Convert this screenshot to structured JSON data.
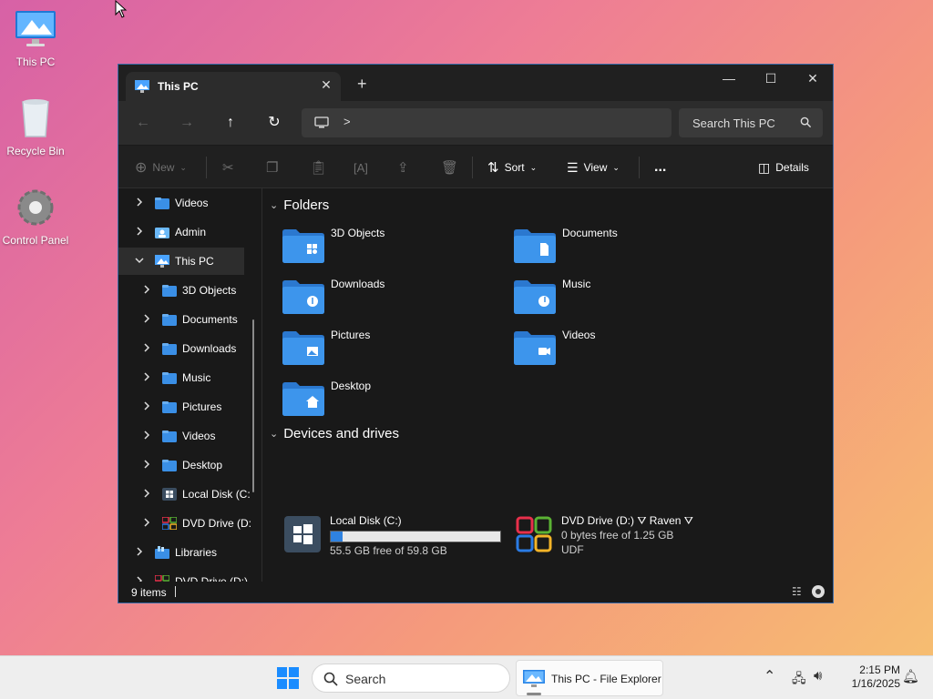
{
  "desktop": {
    "icons": [
      {
        "label": "This PC"
      },
      {
        "label": "Recycle Bin"
      },
      {
        "label": "Control Panel"
      }
    ]
  },
  "window": {
    "tab_title": "This PC",
    "toolbar": {
      "new_label": "New",
      "sort_label": "Sort",
      "view_label": "View",
      "more_label": "...",
      "details_label": "Details"
    },
    "search_placeholder": "Search This PC",
    "address_chevron": ">",
    "nav_items": [
      {
        "label": "Videos",
        "icon": "videos-folder-icon",
        "expanded": false
      },
      {
        "label": "Admin",
        "icon": "user-folder-icon",
        "expanded": false
      },
      {
        "label": "This PC",
        "icon": "this-pc-icon",
        "expanded": true,
        "selected": true
      },
      {
        "label": "3D Objects",
        "icon": "folder-icon",
        "expanded": false
      },
      {
        "label": "Documents",
        "icon": "folder-icon",
        "expanded": false
      },
      {
        "label": "Downloads",
        "icon": "folder-icon",
        "expanded": false
      },
      {
        "label": "Music",
        "icon": "folder-icon",
        "expanded": false
      },
      {
        "label": "Pictures",
        "icon": "folder-icon",
        "expanded": false
      },
      {
        "label": "Videos",
        "icon": "folder-icon",
        "expanded": false
      },
      {
        "label": "Desktop",
        "icon": "folder-icon",
        "expanded": false
      },
      {
        "label": "Local Disk (C:",
        "icon": "disk-icon",
        "expanded": false
      },
      {
        "label": "DVD Drive (D:",
        "icon": "dvd-icon",
        "expanded": false
      },
      {
        "label": "Libraries",
        "icon": "libraries-icon",
        "expanded": false
      },
      {
        "label": "DVD Drive (D:)",
        "icon": "dvd-icon",
        "expanded": false
      }
    ],
    "sections": {
      "folders": "Folders",
      "devices": "Devices and drives"
    },
    "folders": [
      {
        "label": "3D Objects",
        "badge": "3d"
      },
      {
        "label": "Documents",
        "badge": "doc"
      },
      {
        "label": "Downloads",
        "badge": "down"
      },
      {
        "label": "Music",
        "badge": "music"
      },
      {
        "label": "Pictures",
        "badge": "pic"
      },
      {
        "label": "Videos",
        "badge": "vid"
      },
      {
        "label": "Desktop",
        "badge": "home"
      }
    ],
    "drives": [
      {
        "name": "Local Disk (C:)",
        "free_text": "55.5 GB free of 59.8 GB",
        "used_fraction": 0.07
      },
      {
        "name": "DVD Drive (D:) ⛛ Raven ⛛",
        "free_text": "0 bytes free of 1.25 GB",
        "fs": "UDF"
      }
    ],
    "status_count": "9 items"
  },
  "taskbar": {
    "search_placeholder": "Search",
    "app_label": "This PC - File Explorer",
    "time": "2:15 PM",
    "date": "1/16/2025"
  },
  "colors": {
    "accent": "#2f82e0",
    "folder": "#3a8fe6",
    "window_bg": "#191919"
  }
}
